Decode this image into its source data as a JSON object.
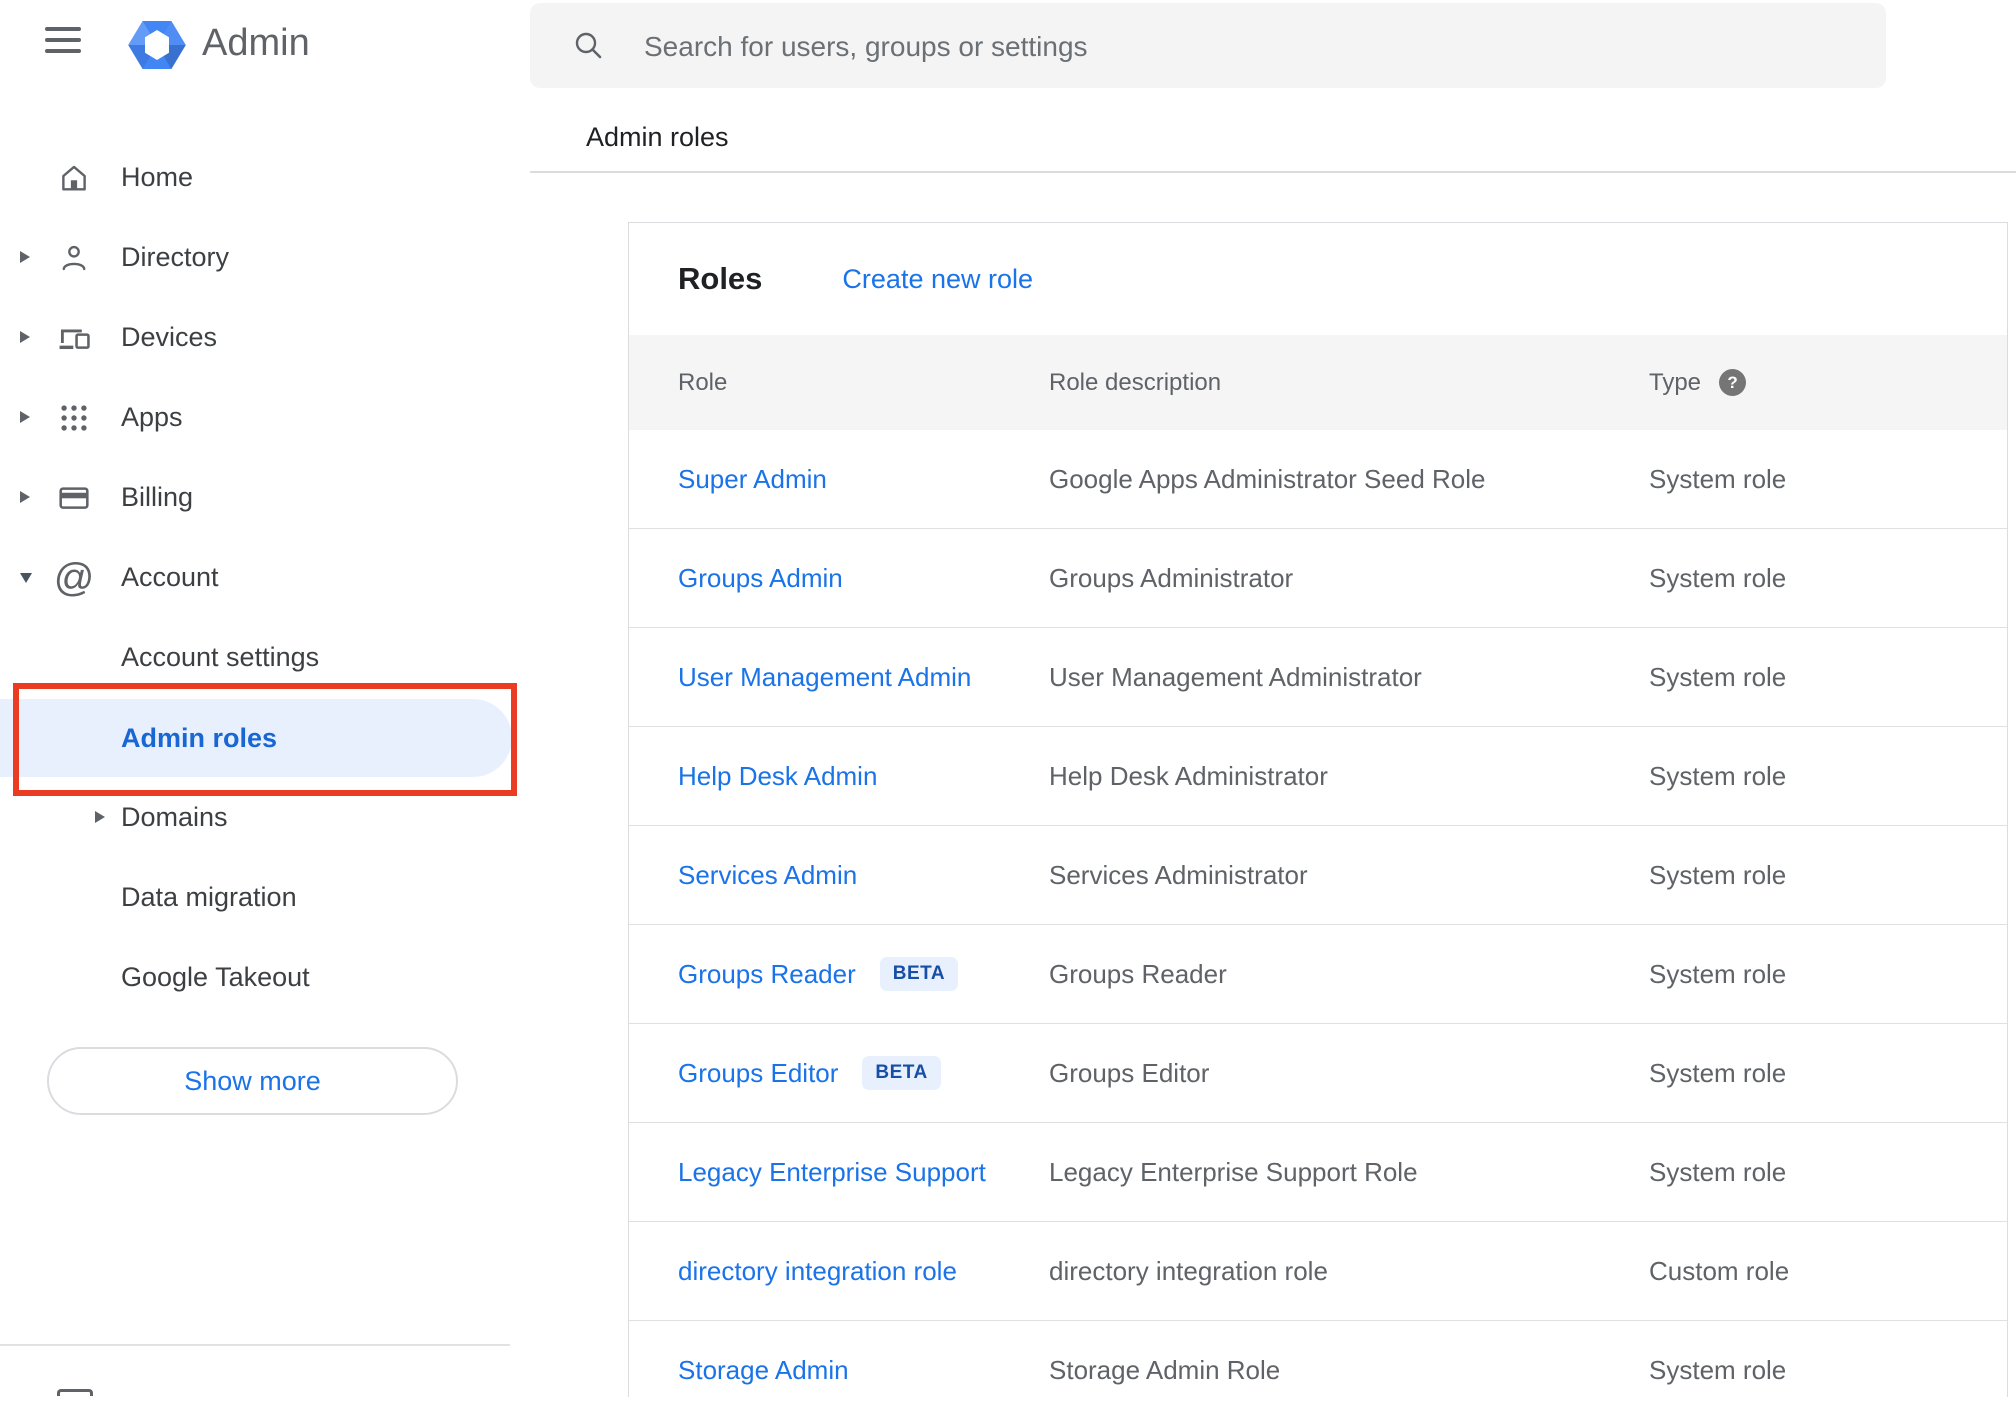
{
  "header": {
    "app_title": "Admin",
    "search_placeholder": "Search for users, groups or settings",
    "breadcrumb": "Admin roles"
  },
  "sidebar": {
    "items": [
      {
        "label": "Home",
        "icon": "home-icon",
        "expandable": false
      },
      {
        "label": "Directory",
        "icon": "person-icon",
        "expandable": true
      },
      {
        "label": "Devices",
        "icon": "devices-icon",
        "expandable": true
      },
      {
        "label": "Apps",
        "icon": "apps-grid-icon",
        "expandable": true
      },
      {
        "label": "Billing",
        "icon": "billing-card-icon",
        "expandable": true
      },
      {
        "label": "Account",
        "icon": "at-sign-icon",
        "expandable": true,
        "expanded": true
      }
    ],
    "account_subitems": [
      {
        "label": "Account settings",
        "selected": false
      },
      {
        "label": "Admin roles",
        "selected": true
      },
      {
        "label": "Domains",
        "selected": false,
        "expandable": true
      },
      {
        "label": "Data migration",
        "selected": false
      },
      {
        "label": "Google Takeout",
        "selected": false
      }
    ],
    "show_more_label": "Show more"
  },
  "main": {
    "card_title": "Roles",
    "create_link": "Create new role",
    "beta_label": "BETA",
    "table": {
      "columns": [
        "Role",
        "Role description",
        "Type"
      ],
      "rows": [
        {
          "role": "Super Admin",
          "description": "Google Apps Administrator Seed Role",
          "type": "System role",
          "beta": false
        },
        {
          "role": "Groups Admin",
          "description": "Groups Administrator",
          "type": "System role",
          "beta": false
        },
        {
          "role": "User Management Admin",
          "description": "User Management Administrator",
          "type": "System role",
          "beta": false
        },
        {
          "role": "Help Desk Admin",
          "description": "Help Desk Administrator",
          "type": "System role",
          "beta": false
        },
        {
          "role": "Services Admin",
          "description": "Services Administrator",
          "type": "System role",
          "beta": false
        },
        {
          "role": "Groups Reader",
          "description": "Groups Reader",
          "type": "System role",
          "beta": true
        },
        {
          "role": "Groups Editor",
          "description": "Groups Editor",
          "type": "System role",
          "beta": true
        },
        {
          "role": "Legacy Enterprise Support",
          "description": "Legacy Enterprise Support Role",
          "type": "System role",
          "beta": false
        },
        {
          "role": "directory integration role",
          "description": "directory integration role",
          "type": "Custom role",
          "beta": false
        },
        {
          "role": "Storage Admin",
          "description": "Storage Admin Role",
          "type": "System role",
          "beta": false
        }
      ]
    }
  },
  "colors": {
    "accent_blue": "#1a73e8",
    "selected_nav_blue": "#1967d2",
    "beta_text_blue": "#174ea6",
    "beta_bg": "#e8f0fe",
    "selected_pill_bg": "#e8f0fe",
    "annotation_red": "#ea3b23",
    "text_dark": "#202124",
    "text_gray": "#5f6368",
    "divider": "#e0e0e0",
    "table_header_bg": "#f5f5f5",
    "search_bg": "#f4f4f4",
    "logo_blue": "#4285f4"
  }
}
